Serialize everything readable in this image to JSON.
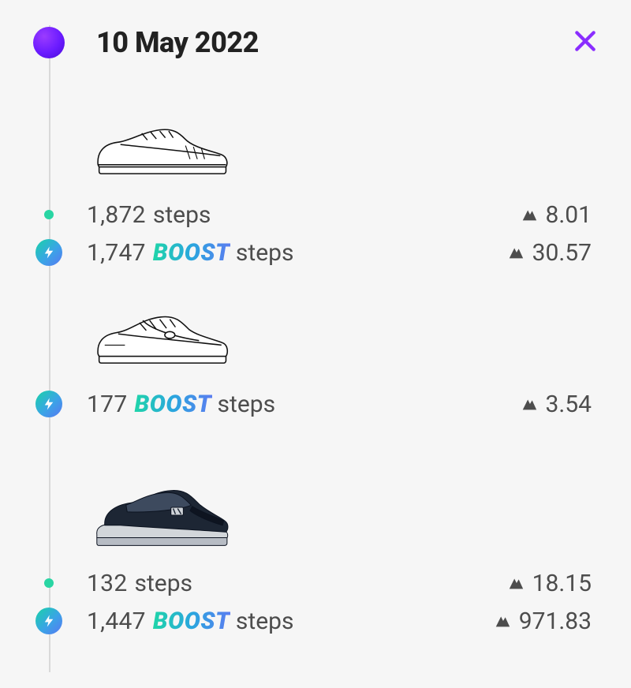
{
  "header": {
    "date": "10 May 2022"
  },
  "shoes": [
    {
      "kind": "outline-low",
      "rows": [
        {
          "type": "normal",
          "count": "1,872",
          "suffix": "steps",
          "value": "8.01"
        },
        {
          "type": "boost",
          "count": "1,747",
          "boost_label": "BOOST",
          "suffix": "steps",
          "value": "30.57"
        }
      ]
    },
    {
      "kind": "outline-dunk",
      "rows": [
        {
          "type": "boost",
          "count": "177",
          "boost_label": "BOOST",
          "suffix": "steps",
          "value": "3.54"
        }
      ]
    },
    {
      "kind": "dark-runner",
      "rows": [
        {
          "type": "normal",
          "count": "132",
          "suffix": "steps",
          "value": "18.15"
        },
        {
          "type": "boost",
          "count": "1,447",
          "boost_label": "BOOST",
          "suffix": "steps",
          "value": "971.83"
        }
      ]
    }
  ]
}
